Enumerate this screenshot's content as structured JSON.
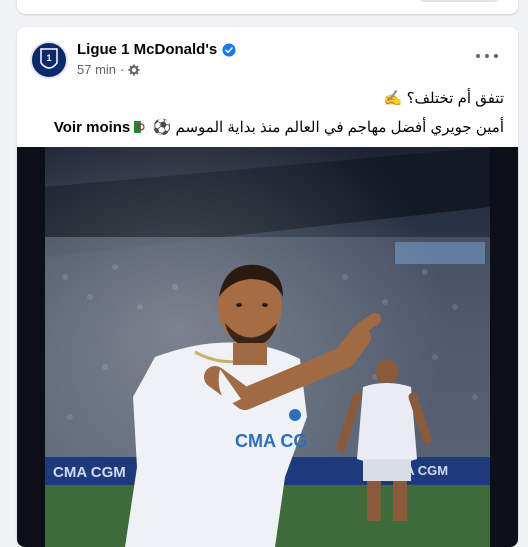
{
  "post": {
    "page_name": "Ligue 1 McDonald's",
    "time": "57 min",
    "caption_line1": "تتفق أم تختلف؟ ✍️",
    "caption_line2": "أمين جويري أفضل مهاجم في العالم منذ بداية الموسم ⚽",
    "see_less_label": "Voir moins",
    "more_options_icon": "more-dots-icon",
    "privacy_icon": "gear-icon",
    "verified_icon": "verified-badge-icon"
  },
  "photo": {
    "banner_text": "CMA CGM",
    "jersey_sponsor": "CMA CG"
  },
  "colors": {
    "background": "#f0f2f5",
    "card": "#ffffff",
    "verified_blue": "#1877f2",
    "meta_gray": "#65676b"
  }
}
